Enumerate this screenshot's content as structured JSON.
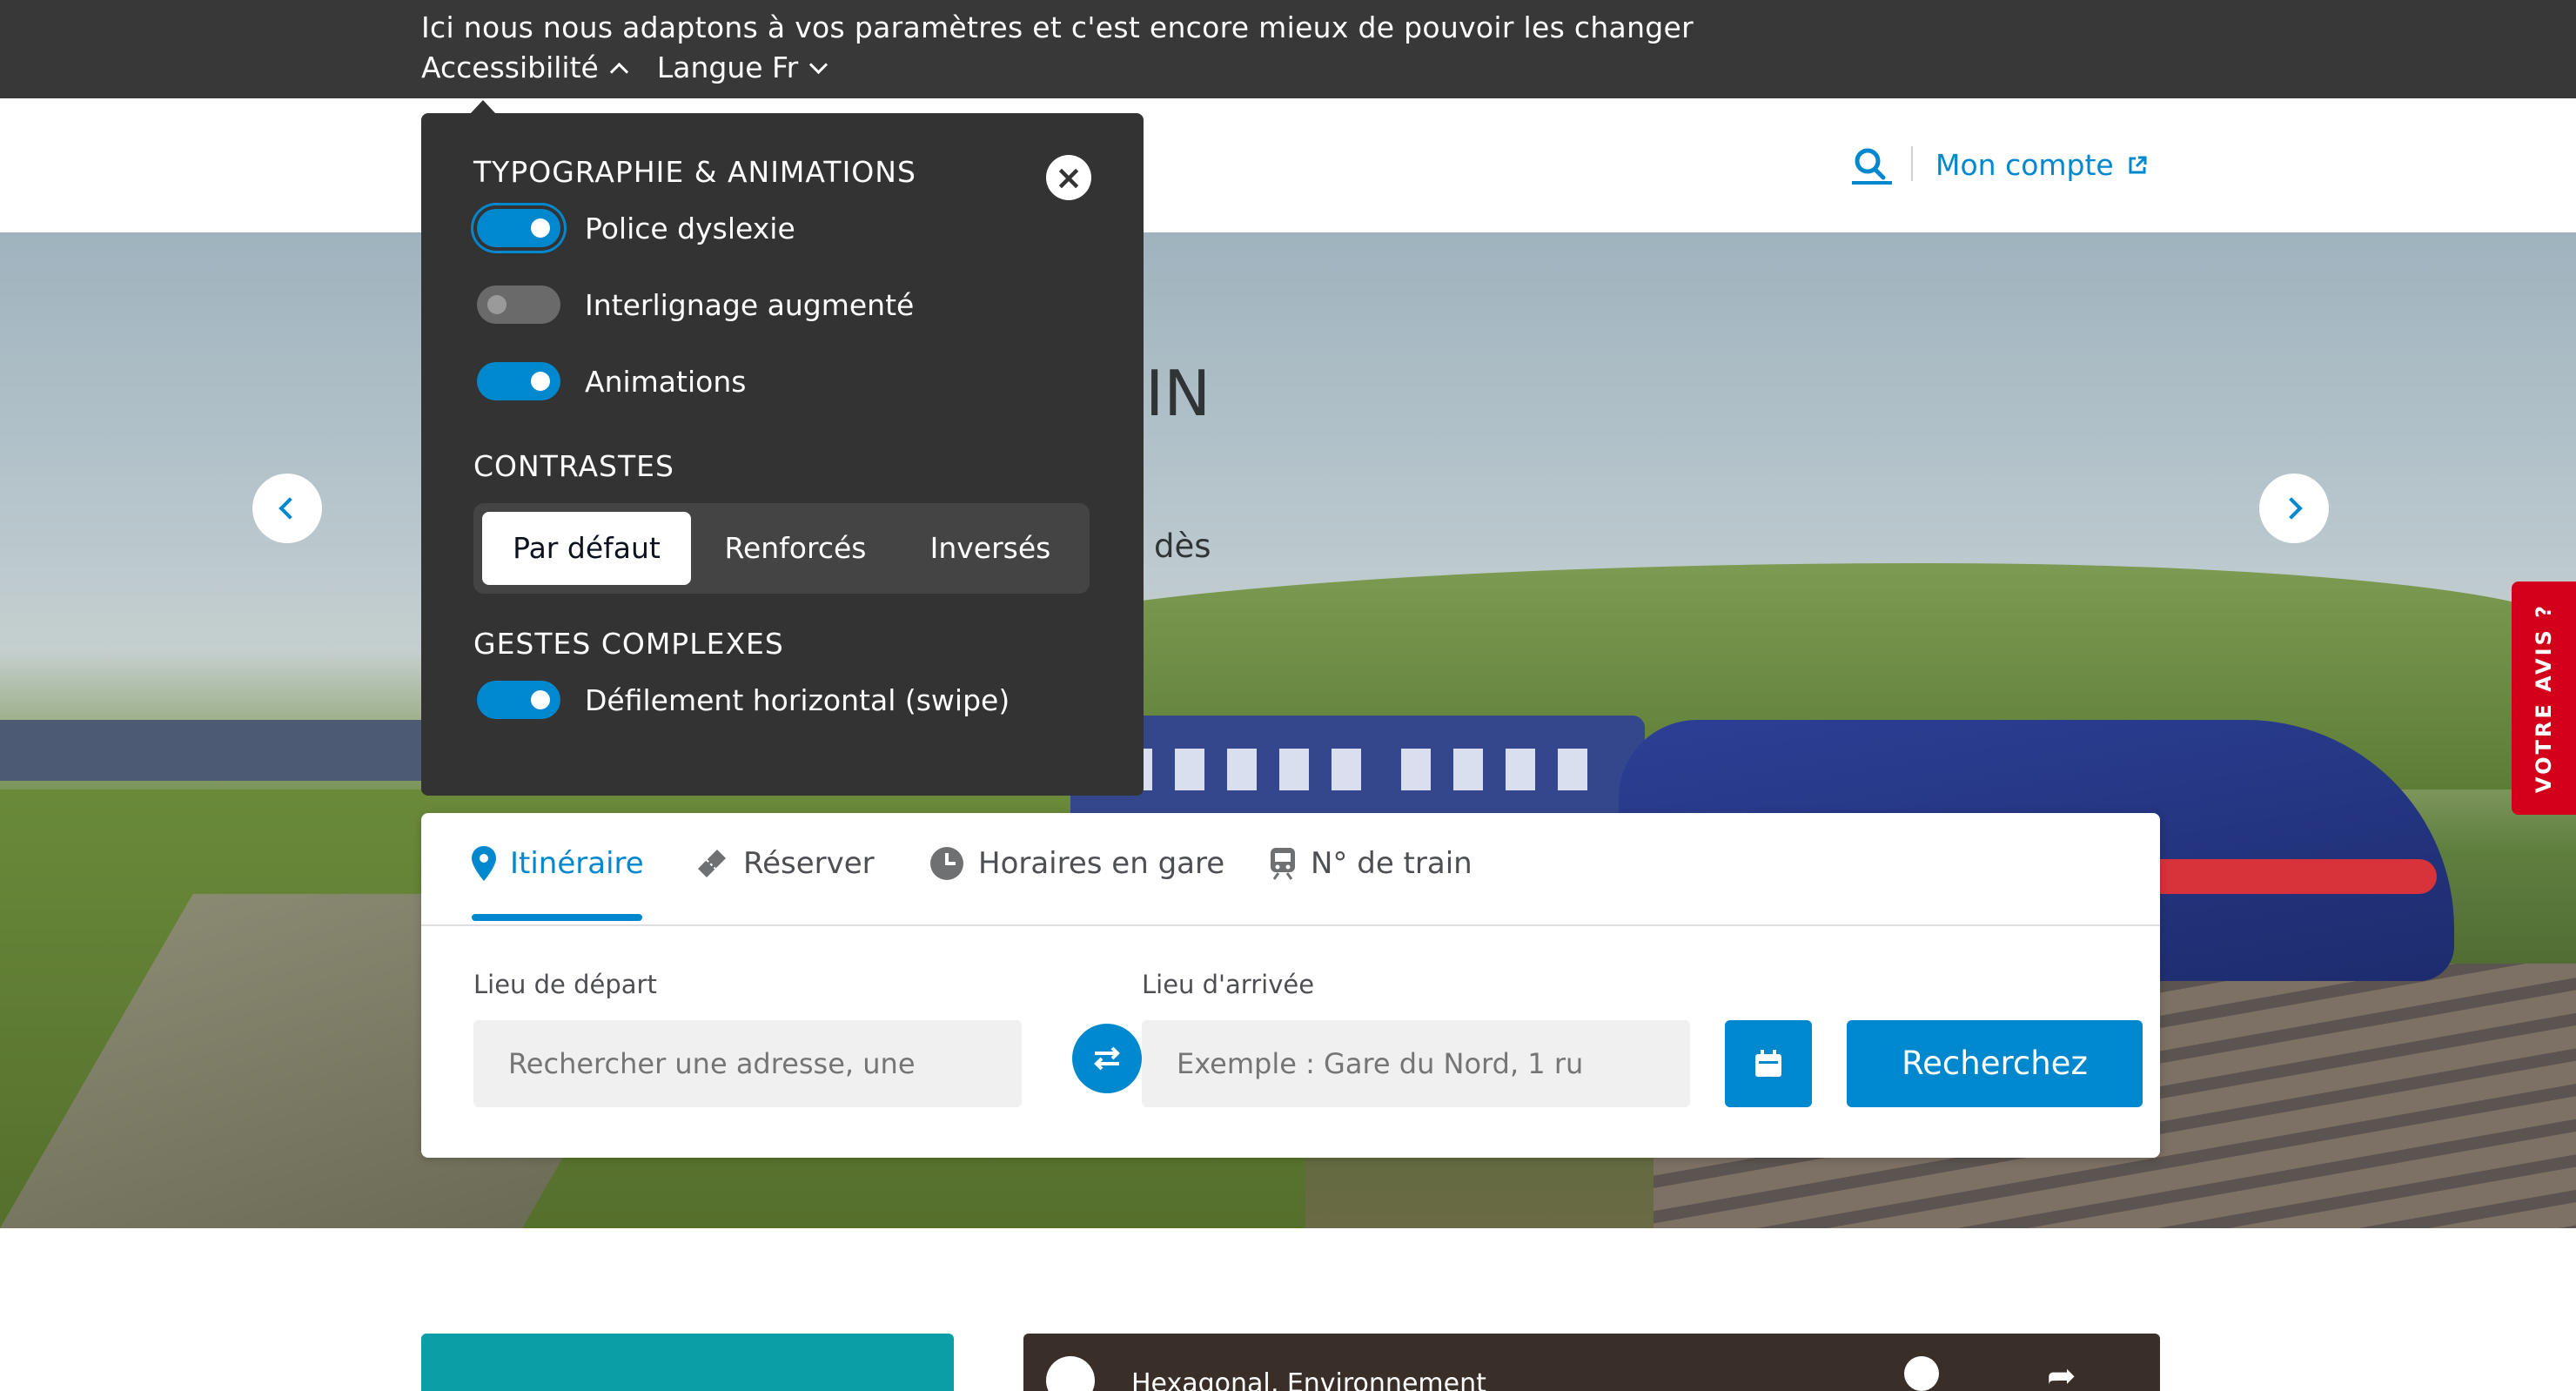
{
  "topbar": {
    "message": "Ici nous nous adaptons à vos paramètres et c'est encore mieux de pouvoir les changer",
    "accessibility_label": "Accessibilité",
    "language_label": "Langue Fr"
  },
  "header": {
    "account_label": "Mon compte"
  },
  "hero": {
    "title_fragment": "IN",
    "subtitle_fragment": "dès",
    "feedback_label": "VOTRE AVIS ?"
  },
  "accessibility_panel": {
    "typography_heading": "TYPOGRAPHIE & ANIMATIONS",
    "toggles": [
      {
        "label": "Police dyslexie",
        "on": true
      },
      {
        "label": "Interlignage augmenté",
        "on": false
      },
      {
        "label": "Animations",
        "on": true
      }
    ],
    "contrast_heading": "CONTRASTES",
    "contrast_options": [
      "Par défaut",
      "Renforcés",
      "Inversés"
    ],
    "contrast_selected": "Par défaut",
    "gestures_heading": "GESTES COMPLEXES",
    "swipe_toggle": {
      "label": "Défilement horizontal (swipe)",
      "on": true
    }
  },
  "booking": {
    "tabs": [
      {
        "label": "Itinéraire",
        "icon": "map-pin-icon",
        "active": true
      },
      {
        "label": "Réserver",
        "icon": "ticket-icon",
        "active": false
      },
      {
        "label": "Horaires en gare",
        "icon": "clock-icon",
        "active": false
      },
      {
        "label": "N° de train",
        "icon": "train-icon",
        "active": false
      }
    ],
    "departure_label": "Lieu de départ",
    "departure_placeholder": "Rechercher une adresse, une",
    "arrival_label": "Lieu d'arrivée",
    "arrival_placeholder": "Exemple : Gare du Nord, 1 ru",
    "search_button": "Recherchez"
  },
  "video": {
    "title": "Hexagonal, Environnement"
  },
  "colors": {
    "accent": "#0088ce",
    "topbar": "#383838",
    "panel": "#333333",
    "feedback": "#d2001a",
    "teal_card": "#0c9ea7"
  }
}
